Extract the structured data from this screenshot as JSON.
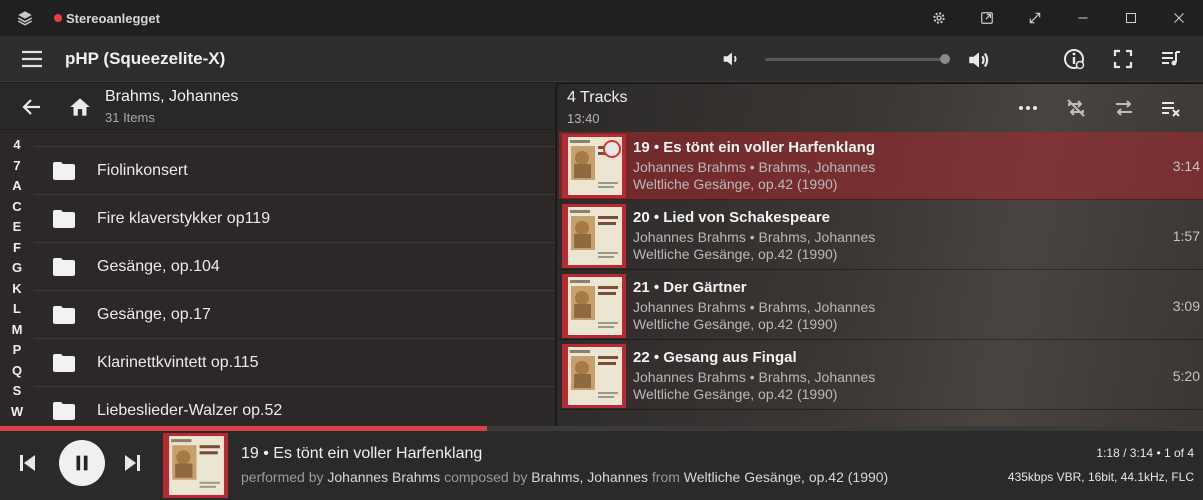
{
  "window": {
    "title": "Stereoanlegget",
    "controls": [
      "gear-icon",
      "open-external-icon",
      "expand-icon",
      "minimize-icon",
      "maximize-icon",
      "close-icon"
    ]
  },
  "toolbar": {
    "player_name": "pHP (Squeezelite-X)",
    "volume_level_percent": 100,
    "icons": [
      "menu-icon",
      "volume-low-icon",
      "volume-high-icon",
      "info-icon",
      "fullscreen-icon",
      "queue-music-icon"
    ]
  },
  "browse": {
    "title": "Brahms, Johannes",
    "subtitle": "31 Items",
    "jumplist": [
      "4",
      "7",
      "A",
      "C",
      "E",
      "F",
      "G",
      "K",
      "L",
      "M",
      "P",
      "Q",
      "S",
      "W"
    ],
    "items": [
      {
        "label": "Fiolinkonsert"
      },
      {
        "label": "Fire klaverstykker op119"
      },
      {
        "label": "Gesänge, op.104"
      },
      {
        "label": "Gesänge, op.17"
      },
      {
        "label": "Klarinettkvintett op.115"
      },
      {
        "label": "Liebeslieder-Walzer op.52"
      }
    ]
  },
  "queue": {
    "title": "4 Tracks",
    "duration": "13:40",
    "tracks": [
      {
        "title": "19 • Es tönt ein voller Harfenklang",
        "artist": "Johannes Brahms • Brahms, Johannes",
        "album": "Weltliche Gesänge, op.42 (1990)",
        "time": "3:14",
        "current": true
      },
      {
        "title": "20 • Lied von Schakespeare",
        "artist": "Johannes Brahms • Brahms, Johannes",
        "album": "Weltliche Gesänge, op.42 (1990)",
        "time": "1:57",
        "current": false
      },
      {
        "title": "21 • Der Gärtner",
        "artist": "Johannes Brahms • Brahms, Johannes",
        "album": "Weltliche Gesänge, op.42 (1990)",
        "time": "3:09",
        "current": false
      },
      {
        "title": "22 • Gesang aus Fingal",
        "artist": "Johannes Brahms • Brahms, Johannes",
        "album": "Weltliche Gesänge, op.42 (1990)",
        "time": "5:20",
        "current": false
      }
    ]
  },
  "now_playing": {
    "progress_fraction": 0.405,
    "title": "19 • Es tönt ein voller Harfenklang",
    "performed_prefix": "performed by",
    "performer": "Johannes Brahms",
    "composed_prefix": "composed by",
    "composer": "Brahms, Johannes",
    "from_prefix": "from",
    "album": "Weltliche Gesänge, op.42 (1990)",
    "position": "1:18 / 3:14 • 1 of 4",
    "format": "435kbps VBR, 16bit, 44.1kHz, FLC"
  },
  "colors": {
    "accent": "#d9414a",
    "current_row": "#8a2a2e"
  }
}
